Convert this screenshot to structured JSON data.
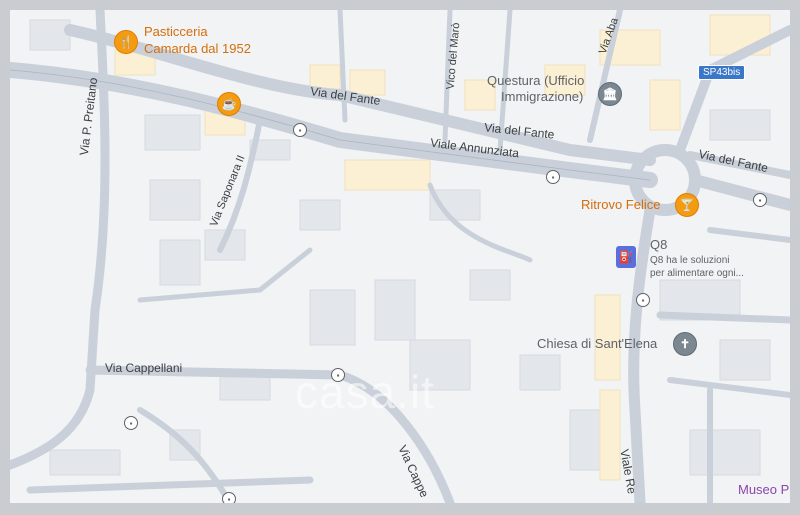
{
  "pois": {
    "pasticceria_line1": "Pasticceria",
    "pasticceria_line2": "Camarda dal 1952",
    "questura_line1": "Questura (Ufficio",
    "questura_line2": "Immigrazione)",
    "ritrovo": "Ritrovo Felice",
    "q8_name": "Q8",
    "q8_desc_line1": "Q8 ha le soluzioni",
    "q8_desc_line2": "per alimentare ogni...",
    "chiesa": "Chiesa di Sant'Elena",
    "museo": "Museo P"
  },
  "roads": {
    "via_del_fante_1": "Via del Fante",
    "via_del_fante_2": "Via del Fante",
    "via_del_fante_3": "Via del Fante",
    "viale_annunziata": "Viale Annunziata",
    "vico_del_maro": "Vico del Marò",
    "via_aba": "Via Aba",
    "via_saponara": "Via Saponara II",
    "via_preitano": "Via P. Preitano",
    "via_cappellani": "Via Cappellani",
    "via_cappe": "Via Cappe",
    "viale_re": "Viale Re"
  },
  "badge": "SP43bis",
  "watermark": "casa.it",
  "icons": {
    "restaurant": "restaurant-icon",
    "cafe": "cafe-icon",
    "government": "government-icon",
    "bar": "bar-icon",
    "fuel": "fuel-icon",
    "church": "church-icon",
    "bus": "bus-stop-icon"
  },
  "colors": {
    "road": "#c5ccd6",
    "poi_orange": "#d56e0c",
    "badge": "#3a77c8"
  }
}
